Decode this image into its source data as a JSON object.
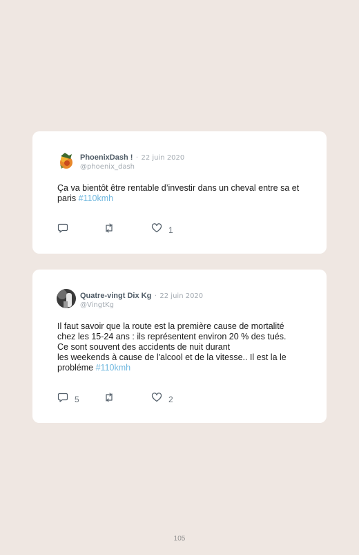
{
  "tweets": [
    {
      "name": "PhoenixDash !",
      "separator": "·",
      "date": "22 juin 2020",
      "handle": "@phoenix_dash",
      "text": "Ça va bientôt être rentable d’investir dans un cheval entre sa et paris",
      "hashtag": "#110kmh",
      "replies": "",
      "retweets": "",
      "likes": "1"
    },
    {
      "name": "Quatre-vingt Dix Kg",
      "separator": "·",
      "date": "22 juin 2020",
      "handle": "@VingtKg",
      "lines": [
        "Il faut savoir que la route est la première cause de mortalité",
        "chez les 15-24 ans : ils représentent environ 20 % des tués.",
        "Ce sont souvent des accidents de nuit durant",
        "les weekends à cause de l'alcool et de la vitesse.. Il est la le",
        "probléme"
      ],
      "hashtag": "#110kmh",
      "replies": "5",
      "retweets": "",
      "likes": "2"
    }
  ],
  "page_number": "105",
  "colors": {
    "background": "#efe7e2",
    "card": "#ffffff",
    "hashtag": "#6fb7de"
  },
  "icons": [
    "reply-icon",
    "retweet-icon",
    "like-icon"
  ]
}
